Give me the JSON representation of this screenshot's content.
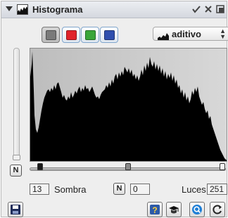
{
  "title": "Histograma",
  "header": {
    "pin_icon": "check-icon",
    "close_icon": "close-icon",
    "detach_icon": "detach-icon"
  },
  "channels": [
    {
      "name": "luminosity",
      "color": "#7a7a7a",
      "active": true
    },
    {
      "name": "red",
      "color": "#e0242c",
      "active": false
    },
    {
      "name": "green",
      "color": "#3aa63a",
      "active": false
    },
    {
      "name": "blue",
      "color": "#2f4fae",
      "active": false
    }
  ],
  "mode_select": {
    "value": "aditivo",
    "icon": "histogram-mini-icon"
  },
  "shadow": {
    "label": "Sombra",
    "value": "13",
    "reset_label": "N"
  },
  "midtone": {
    "value": "0",
    "reset_label": "N"
  },
  "highlight": {
    "label": "Luces",
    "value": "251"
  },
  "vertical_reset_label": "N",
  "slider_positions": {
    "shadow": 13,
    "midtone": 128,
    "highlight": 251,
    "max": 255
  },
  "bottom_buttons": [
    {
      "name": "save-button",
      "icon": "save-icon"
    },
    {
      "name": "help-button",
      "icon": "help-icon"
    },
    {
      "name": "learn-button",
      "icon": "graduation-cap-icon"
    },
    {
      "name": "zoom-button",
      "icon": "magnifier-icon"
    },
    {
      "name": "refresh-button",
      "icon": "refresh-icon"
    }
  ]
}
